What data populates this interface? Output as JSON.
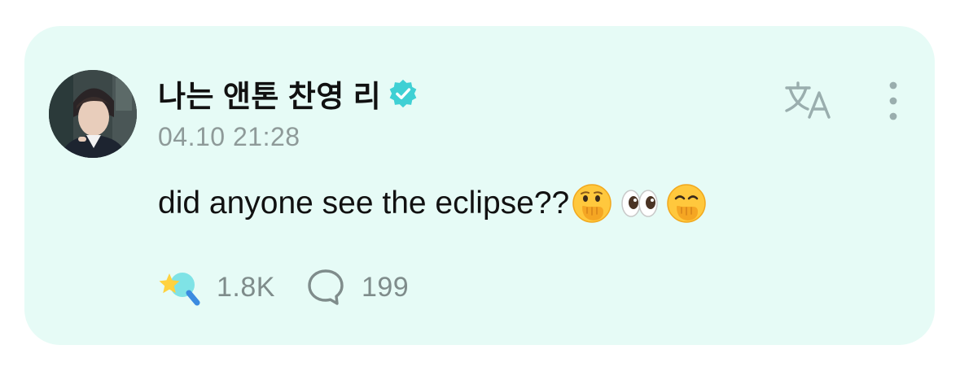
{
  "post": {
    "author_name": "나는 앤톤 찬영 리",
    "timestamp": "04.10 21:28",
    "text": "did anyone see the eclipse??",
    "emojis": [
      "face-with-hand-over-mouth",
      "eyes",
      "face-with-hand-over-mouth"
    ]
  },
  "icons": {
    "verified": "verified-badge-icon",
    "translate": "translate-icon",
    "more": "more-vertical-icon",
    "like": "sparkle-like-icon",
    "comment": "comment-bubble-icon"
  },
  "stats": {
    "likes": "1.8K",
    "comments": "199"
  },
  "colors": {
    "card_background": "#e6fbf6",
    "verified_badge": "#3fd0d4",
    "muted_text": "#8e9a99",
    "primary_text": "#111111"
  }
}
